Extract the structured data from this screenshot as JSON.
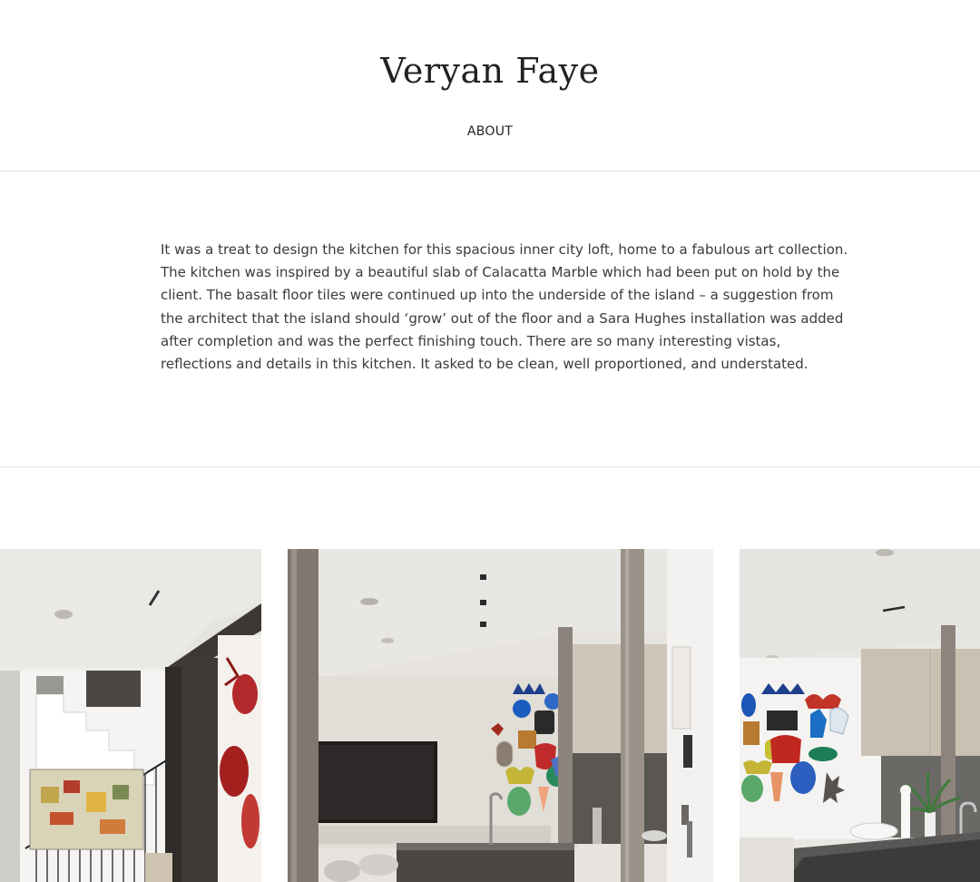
{
  "site": {
    "title": "Veryan Faye"
  },
  "nav": {
    "items": [
      {
        "label": "ABOUT"
      }
    ]
  },
  "intro": {
    "text": "It was a treat to design the kitchen for this spacious inner city loft, home to a fabulous art collection. The kitchen was inspired by a beautiful slab of Calacatta Marble which had been put on hold by the client. The basalt floor tiles were continued up into the underside of the island – a suggestion from the architect that the island should ‘grow’ out of the floor and a Sara Hughes installation was added after completion and was the perfect finishing touch. There are so many interesting vistas, reflections and details in this kitchen. It asked to be clean, well proportioned, and understated."
  },
  "gallery": {
    "photos": [
      {
        "name": "staircase-photo"
      },
      {
        "name": "kitchen-living-photo"
      },
      {
        "name": "kitchen-island-photo"
      }
    ]
  },
  "colors": {
    "border": "#e2e2e2",
    "text": "#3a3a3a",
    "title": "#222222"
  }
}
